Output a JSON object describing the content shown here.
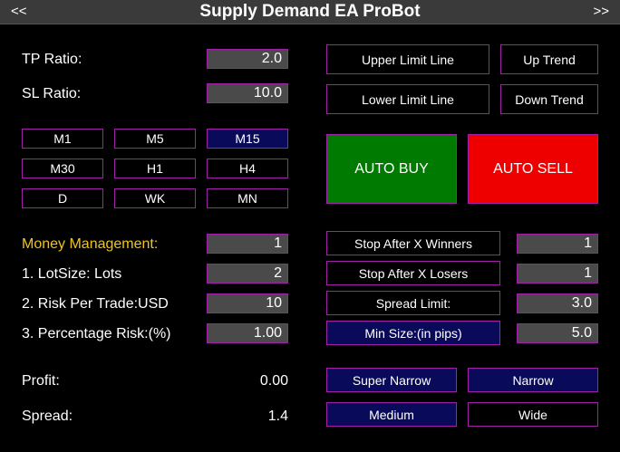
{
  "window": {
    "title": "Supply Demand EA ProBot",
    "prev_label": "<<",
    "next_label": ">>"
  },
  "ratios": {
    "tp_label": "TP Ratio:",
    "tp_value": "2.0",
    "sl_label": "SL Ratio:",
    "sl_value": "10.0"
  },
  "lines": {
    "upper": "Upper Limit Line",
    "lower": "Lower Limit Line",
    "up": "Up Trend",
    "down": "Down Trend"
  },
  "timeframes": [
    "M1",
    "M5",
    "M15",
    "M30",
    "H1",
    "H4",
    "D",
    "WK",
    "MN"
  ],
  "selected_timeframe": "M15",
  "auto": {
    "buy": "AUTO BUY",
    "sell": "AUTO SELL",
    "buy_color": "#007a00",
    "sell_color": "#ee0000"
  },
  "money": {
    "title": "Money Management:",
    "mode_value": "1",
    "lot_label": "1. LotSize: Lots",
    "lot_value": "2",
    "risk_label": "2. Risk Per Trade:USD",
    "risk_value": "10",
    "pct_label": "3. Percentage Risk:(%)",
    "pct_value": "1.00"
  },
  "limits": {
    "winners_label": "Stop After X Winners",
    "winners_value": "1",
    "losers_label": "Stop After X Losers",
    "losers_value": "1",
    "spread_label": "Spread Limit:",
    "spread_value": "3.0",
    "minsize_label": "Min Size:(in pips)",
    "minsize_value": "5.0"
  },
  "stats": {
    "profit_label": "Profit:",
    "profit_value": "0.00",
    "spread_label": "Spread:",
    "spread_value": "1.4"
  },
  "zones": {
    "super_narrow": "Super Narrow",
    "narrow": "Narrow",
    "medium": "Medium",
    "wide": "Wide"
  },
  "colors": {
    "border": "#a020a8",
    "selected_bg": "#0a0a5a",
    "gold": "#f0c419"
  }
}
